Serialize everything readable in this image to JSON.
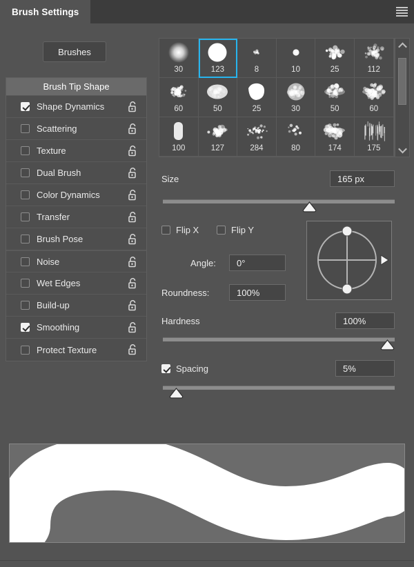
{
  "window": {
    "tab_title": "Brush Settings",
    "menu_icon": "hamburger-menu-icon"
  },
  "left_panel": {
    "brushes_button": "Brushes",
    "header": "Brush Tip Shape",
    "options": [
      {
        "label": "Shape Dynamics",
        "checked": true,
        "lock": "unlocked-padlock-icon"
      },
      {
        "label": "Scattering",
        "checked": false,
        "lock": "unlocked-padlock-icon"
      },
      {
        "label": "Texture",
        "checked": false,
        "lock": "unlocked-padlock-icon"
      },
      {
        "label": "Dual Brush",
        "checked": false,
        "lock": "unlocked-padlock-icon"
      },
      {
        "label": "Color Dynamics",
        "checked": false,
        "lock": "unlocked-padlock-icon"
      },
      {
        "label": "Transfer",
        "checked": false,
        "lock": "unlocked-padlock-icon"
      },
      {
        "label": "Brush Pose",
        "checked": false,
        "lock": "unlocked-padlock-icon"
      },
      {
        "label": "Noise",
        "checked": false,
        "lock": "unlocked-padlock-icon"
      },
      {
        "label": "Wet Edges",
        "checked": false,
        "lock": "unlocked-padlock-icon"
      },
      {
        "label": "Build-up",
        "checked": false,
        "lock": "unlocked-padlock-icon"
      },
      {
        "label": "Smoothing",
        "checked": true,
        "lock": "unlocked-padlock-icon"
      },
      {
        "label": "Protect Texture",
        "checked": false,
        "lock": "unlocked-padlock-icon"
      }
    ]
  },
  "brush_grid": {
    "selected_index": 1,
    "selection_color": "#27b5ef",
    "presets": [
      {
        "size": "30",
        "style": "soft-round"
      },
      {
        "size": "123",
        "style": "hard-round"
      },
      {
        "size": "8",
        "style": "speckle-small"
      },
      {
        "size": "10",
        "style": "blob-small"
      },
      {
        "size": "25",
        "style": "splatter"
      },
      {
        "size": "112",
        "style": "rough-scatter"
      },
      {
        "size": "60",
        "style": "granular-round"
      },
      {
        "size": "50",
        "style": "soft-oval"
      },
      {
        "size": "25",
        "style": "hard-chunk"
      },
      {
        "size": "30",
        "style": "cloud-round"
      },
      {
        "size": "50",
        "style": "dry-brush"
      },
      {
        "size": "60",
        "style": "dry-brush-wide"
      },
      {
        "size": "100",
        "style": "flat-tip"
      },
      {
        "size": "127",
        "style": "charcoal"
      },
      {
        "size": "284",
        "style": "spatter-fine"
      },
      {
        "size": "80",
        "style": "dots-sparse"
      },
      {
        "size": "174",
        "style": "smear"
      },
      {
        "size": "175",
        "style": "hair-streaks"
      },
      {
        "size": "",
        "style": "chalk-clump"
      },
      {
        "size": "",
        "style": "half-dome"
      },
      {
        "size": "",
        "style": "fine-spray"
      },
      {
        "size": "",
        "style": "grit"
      },
      {
        "size": "",
        "style": "faint-texture"
      },
      {
        "size": "",
        "style": "flecks"
      }
    ],
    "scrollbar": {
      "up_icon": "chevron-up-icon",
      "down_icon": "chevron-down-icon",
      "thumb_position_percent": 12
    }
  },
  "controls": {
    "size": {
      "label": "Size",
      "value": "165 px",
      "slider_percent": 64
    },
    "flip_x": {
      "label": "Flip X",
      "checked": false
    },
    "flip_y": {
      "label": "Flip Y",
      "checked": false
    },
    "angle": {
      "label": "Angle:",
      "value": "0°"
    },
    "roundness": {
      "label": "Roundness:",
      "value": "100%"
    },
    "hardness": {
      "label": "Hardness",
      "value": "100%",
      "slider_percent": 100
    },
    "spacing": {
      "label": "Spacing",
      "value": "5%",
      "checked": true,
      "slider_percent": 3
    },
    "angle_widget": {
      "name": "angle-roundness-dial",
      "top_handle": true,
      "bottom_handle": true,
      "pointer_direction": "right"
    }
  },
  "preview": {
    "name": "brush-stroke-preview",
    "stroke_color": "#ffffff",
    "background_color": "#6b6b6b",
    "description": "thick white S-curve brush stroke"
  }
}
